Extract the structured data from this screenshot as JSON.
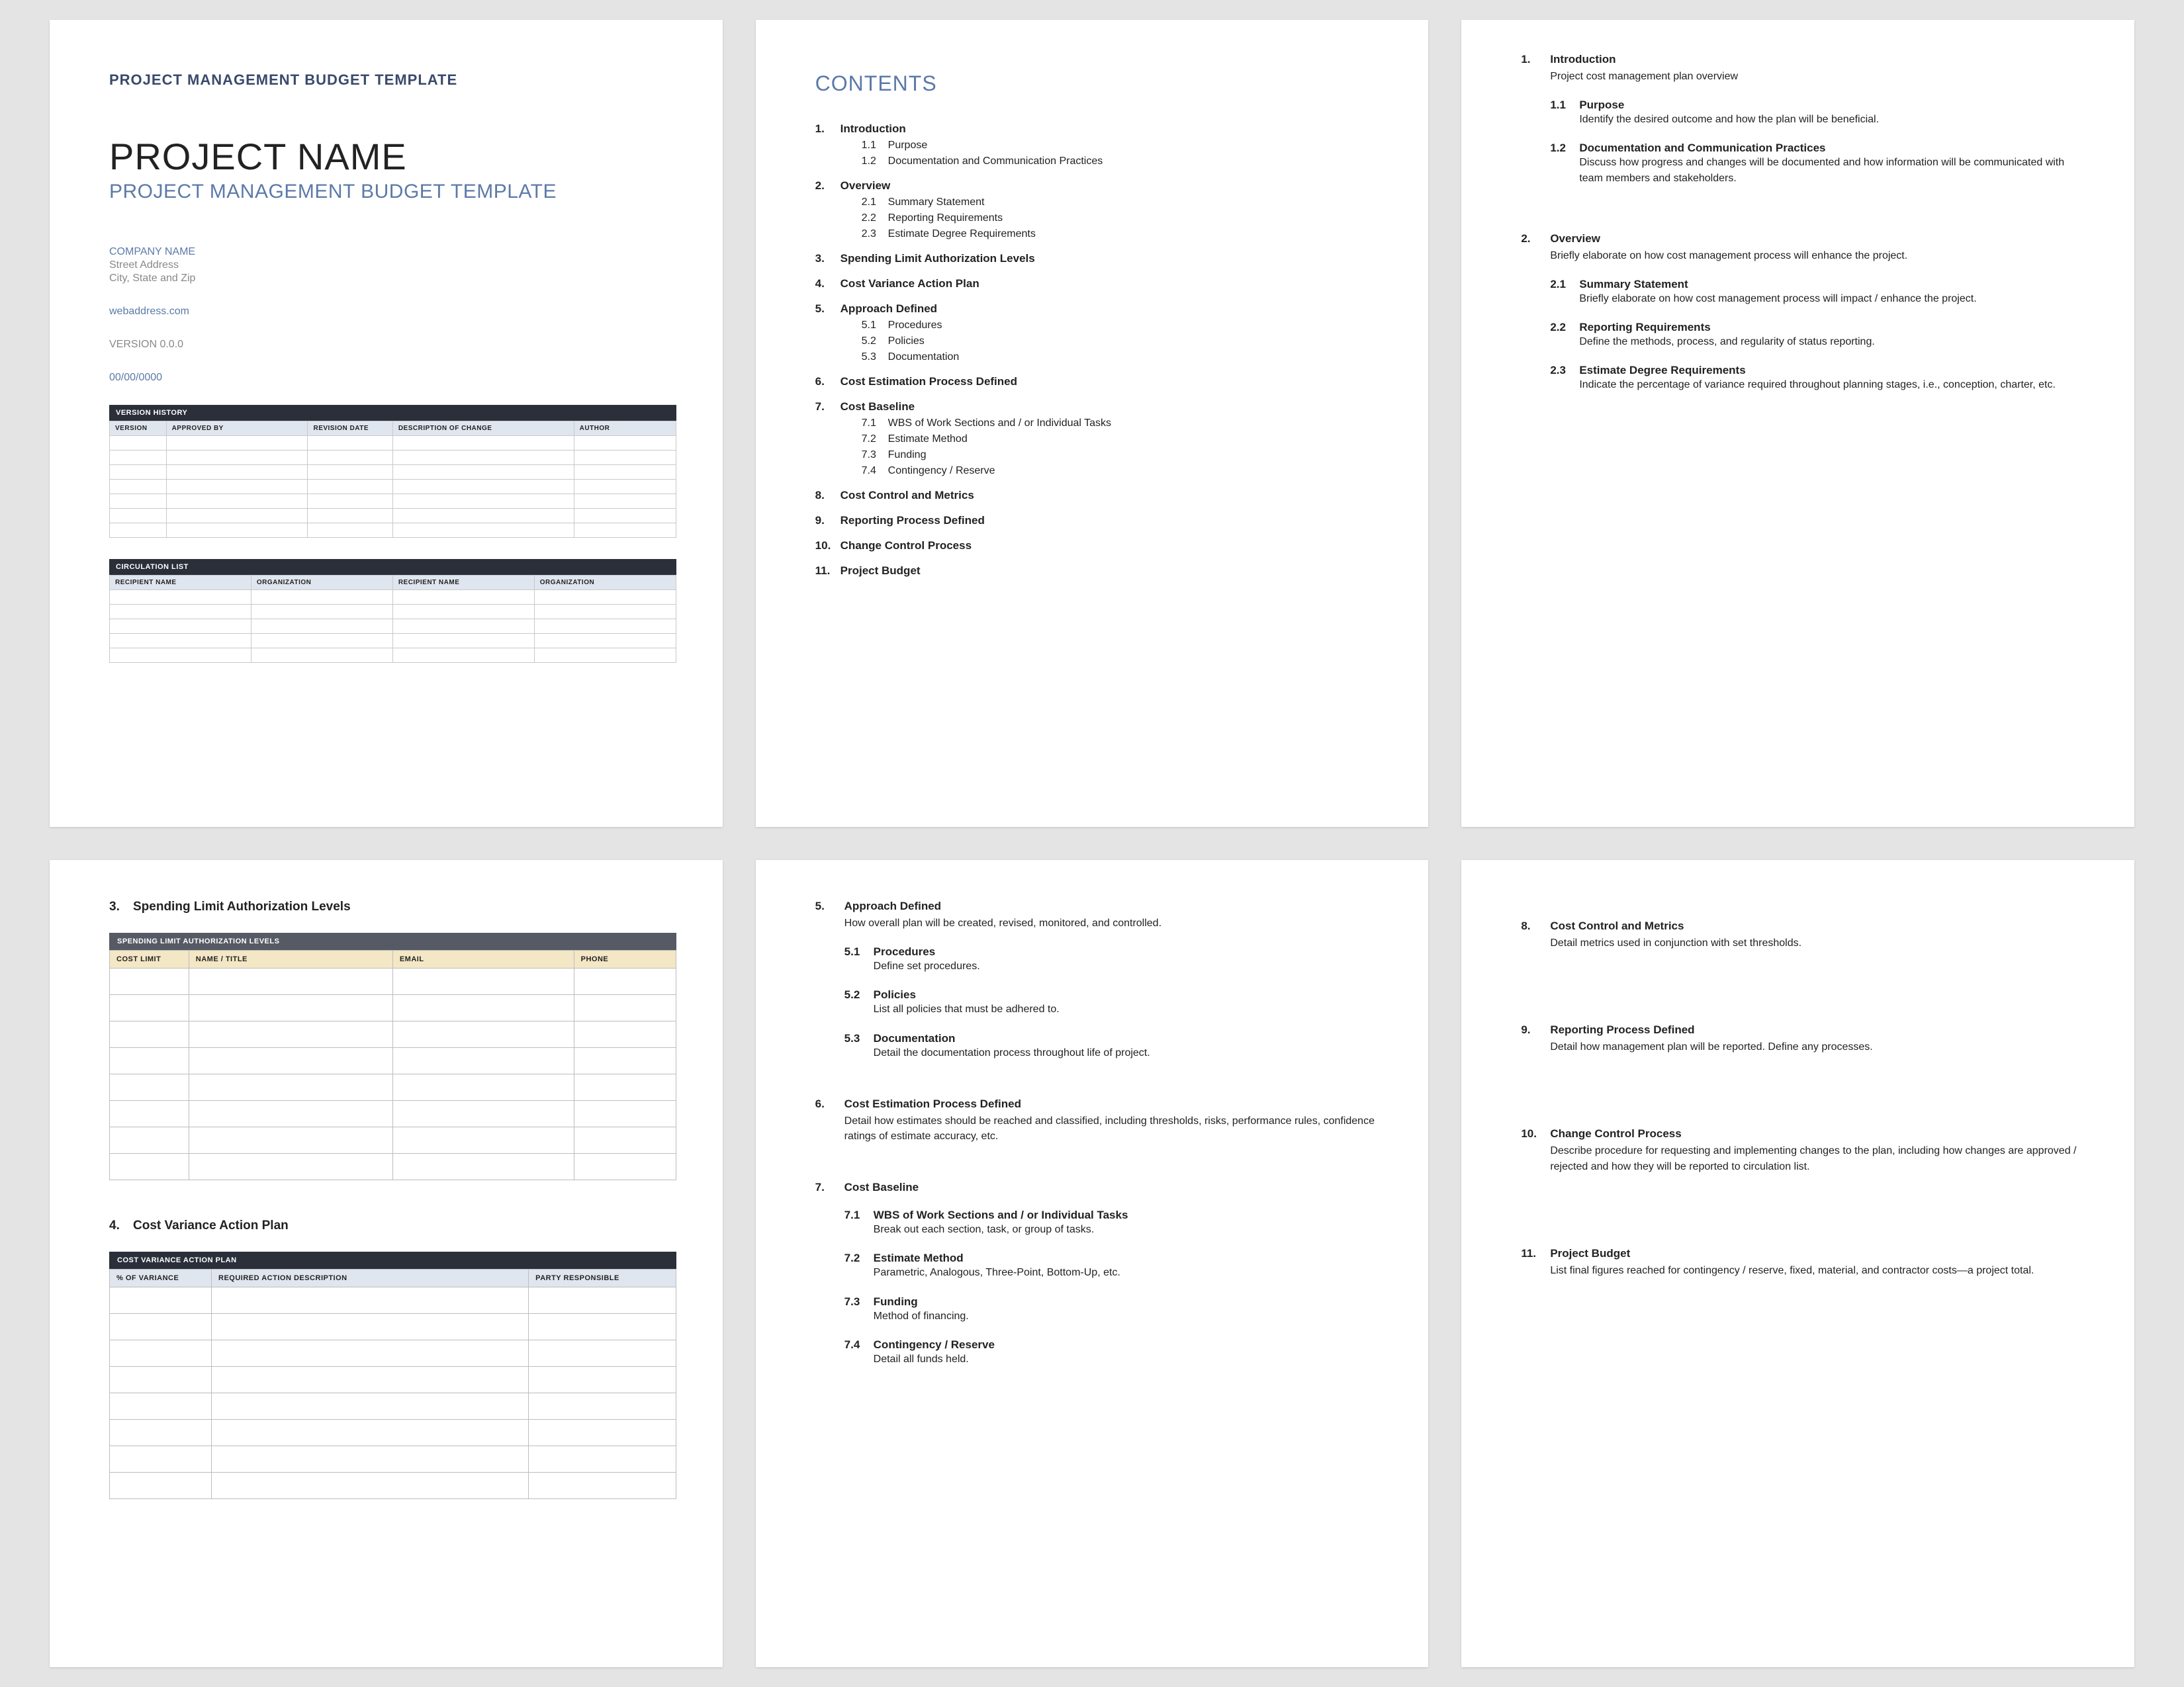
{
  "page1": {
    "pretitle": "PROJECT MANAGEMENT BUDGET TEMPLATE",
    "title": "PROJECT NAME",
    "subtitle": "PROJECT MANAGEMENT BUDGET TEMPLATE",
    "company": "COMPANY NAME",
    "street": "Street Address",
    "citystate": "City, State and Zip",
    "web": "webaddress.com",
    "version_label": "VERSION 0.0.0",
    "date": "00/00/0000",
    "version_history": {
      "title": "VERSION HISTORY",
      "headers": [
        "VERSION",
        "APPROVED BY",
        "REVISION DATE",
        "DESCRIPTION OF CHANGE",
        "AUTHOR"
      ]
    },
    "circulation": {
      "title": "CIRCULATION LIST",
      "headers": [
        "RECIPIENT NAME",
        "ORGANIZATION",
        "RECIPIENT NAME",
        "ORGANIZATION"
      ]
    }
  },
  "contents": {
    "heading": "CONTENTS",
    "items": [
      {
        "n": "1.",
        "t": "Introduction",
        "subs": [
          {
            "sn": "1.1",
            "t": "Purpose"
          },
          {
            "sn": "1.2",
            "t": "Documentation and Communication Practices"
          }
        ]
      },
      {
        "n": "2.",
        "t": "Overview",
        "subs": [
          {
            "sn": "2.1",
            "t": "Summary Statement"
          },
          {
            "sn": "2.2",
            "t": "Reporting Requirements"
          },
          {
            "sn": "2.3",
            "t": "Estimate Degree Requirements"
          }
        ]
      },
      {
        "n": "3.",
        "t": "Spending Limit Authorization Levels"
      },
      {
        "n": "4.",
        "t": "Cost Variance Action Plan"
      },
      {
        "n": "5.",
        "t": "Approach Defined",
        "subs": [
          {
            "sn": "5.1",
            "t": "Procedures"
          },
          {
            "sn": "5.2",
            "t": "Policies"
          },
          {
            "sn": "5.3",
            "t": "Documentation"
          }
        ]
      },
      {
        "n": "6.",
        "t": "Cost Estimation Process Defined"
      },
      {
        "n": "7.",
        "t": "Cost Baseline",
        "subs": [
          {
            "sn": "7.1",
            "t": "WBS of Work Sections and / or Individual Tasks"
          },
          {
            "sn": "7.2",
            "t": "Estimate Method"
          },
          {
            "sn": "7.3",
            "t": "Funding"
          },
          {
            "sn": "7.4",
            "t": "Contingency / Reserve"
          }
        ]
      },
      {
        "n": "8.",
        "t": "Cost Control and Metrics"
      },
      {
        "n": "9.",
        "t": "Reporting Process Defined"
      },
      {
        "n": "10.",
        "t": "Change Control Process"
      },
      {
        "n": "11.",
        "t": "Project Budget"
      }
    ]
  },
  "p3": {
    "s1": {
      "num": "1.",
      "title": "Introduction",
      "desc": "Project cost management plan overview",
      "subs": [
        {
          "sn": "1.1",
          "t": "Purpose",
          "b": "Identify the desired outcome and how the plan will be beneficial."
        },
        {
          "sn": "1.2",
          "t": "Documentation and Communication Practices",
          "b": "Discuss how progress and changes will be documented and how information will be communicated with team members and stakeholders."
        }
      ]
    },
    "s2": {
      "num": "2.",
      "title": "Overview",
      "desc": "Briefly elaborate on how cost management process will enhance the project.",
      "subs": [
        {
          "sn": "2.1",
          "t": "Summary Statement",
          "b": "Briefly elaborate on how cost management process will impact / enhance the project."
        },
        {
          "sn": "2.2",
          "t": "Reporting Requirements",
          "b": "Define the methods, process, and regularity of status reporting."
        },
        {
          "sn": "2.3",
          "t": "Estimate Degree Requirements",
          "b": "Indicate the percentage of variance required throughout planning stages, i.e., conception, charter, etc."
        }
      ]
    }
  },
  "p4": {
    "s3": {
      "num": "3.",
      "title": "Spending Limit Authorization Levels",
      "table_title": "SPENDING LIMIT AUTHORIZATION LEVELS",
      "headers": [
        "COST LIMIT",
        "NAME / TITLE",
        "EMAIL",
        "PHONE"
      ]
    },
    "s4": {
      "num": "4.",
      "title": "Cost Variance Action Plan",
      "table_title": "COST VARIANCE ACTION PLAN",
      "headers": [
        "% OF VARIANCE",
        "REQUIRED ACTION DESCRIPTION",
        "PARTY RESPONSIBLE"
      ]
    }
  },
  "p5": {
    "s5": {
      "num": "5.",
      "title": "Approach Defined",
      "desc": "How overall plan will be created, revised, monitored, and controlled.",
      "subs": [
        {
          "sn": "5.1",
          "t": "Procedures",
          "b": "Define set procedures."
        },
        {
          "sn": "5.2",
          "t": "Policies",
          "b": "List all policies that must be adhered to."
        },
        {
          "sn": "5.3",
          "t": "Documentation",
          "b": "Detail the documentation process throughout life of project."
        }
      ]
    },
    "s6": {
      "num": "6.",
      "title": "Cost Estimation Process Defined",
      "desc": "Detail how estimates should be reached and classified, including thresholds, risks, performance rules, confidence ratings of estimate accuracy, etc."
    },
    "s7": {
      "num": "7.",
      "title": "Cost Baseline",
      "subs": [
        {
          "sn": "7.1",
          "t": "WBS of Work Sections and / or Individual Tasks",
          "b": "Break out each section, task, or group of tasks."
        },
        {
          "sn": "7.2",
          "t": "Estimate Method",
          "b": "Parametric, Analogous, Three-Point, Bottom-Up, etc."
        },
        {
          "sn": "7.3",
          "t": "Funding",
          "b": "Method of financing."
        },
        {
          "sn": "7.4",
          "t": "Contingency / Reserve",
          "b": "Detail all funds held."
        }
      ]
    }
  },
  "p6": {
    "s8": {
      "num": "8.",
      "title": "Cost Control and Metrics",
      "desc": "Detail metrics used in conjunction with set thresholds."
    },
    "s9": {
      "num": "9.",
      "title": "Reporting Process Defined",
      "desc": "Detail how management plan will be reported. Define any processes."
    },
    "s10": {
      "num": "10.",
      "title": "Change Control Process",
      "desc": "Describe procedure for requesting and implementing changes to the plan, including how changes are approved / rejected and how they will be reported to circulation list."
    },
    "s11": {
      "num": "11.",
      "title": "Project Budget",
      "desc": "List final figures reached for contingency / reserve, fixed, material, and contractor costs—a project total."
    }
  }
}
